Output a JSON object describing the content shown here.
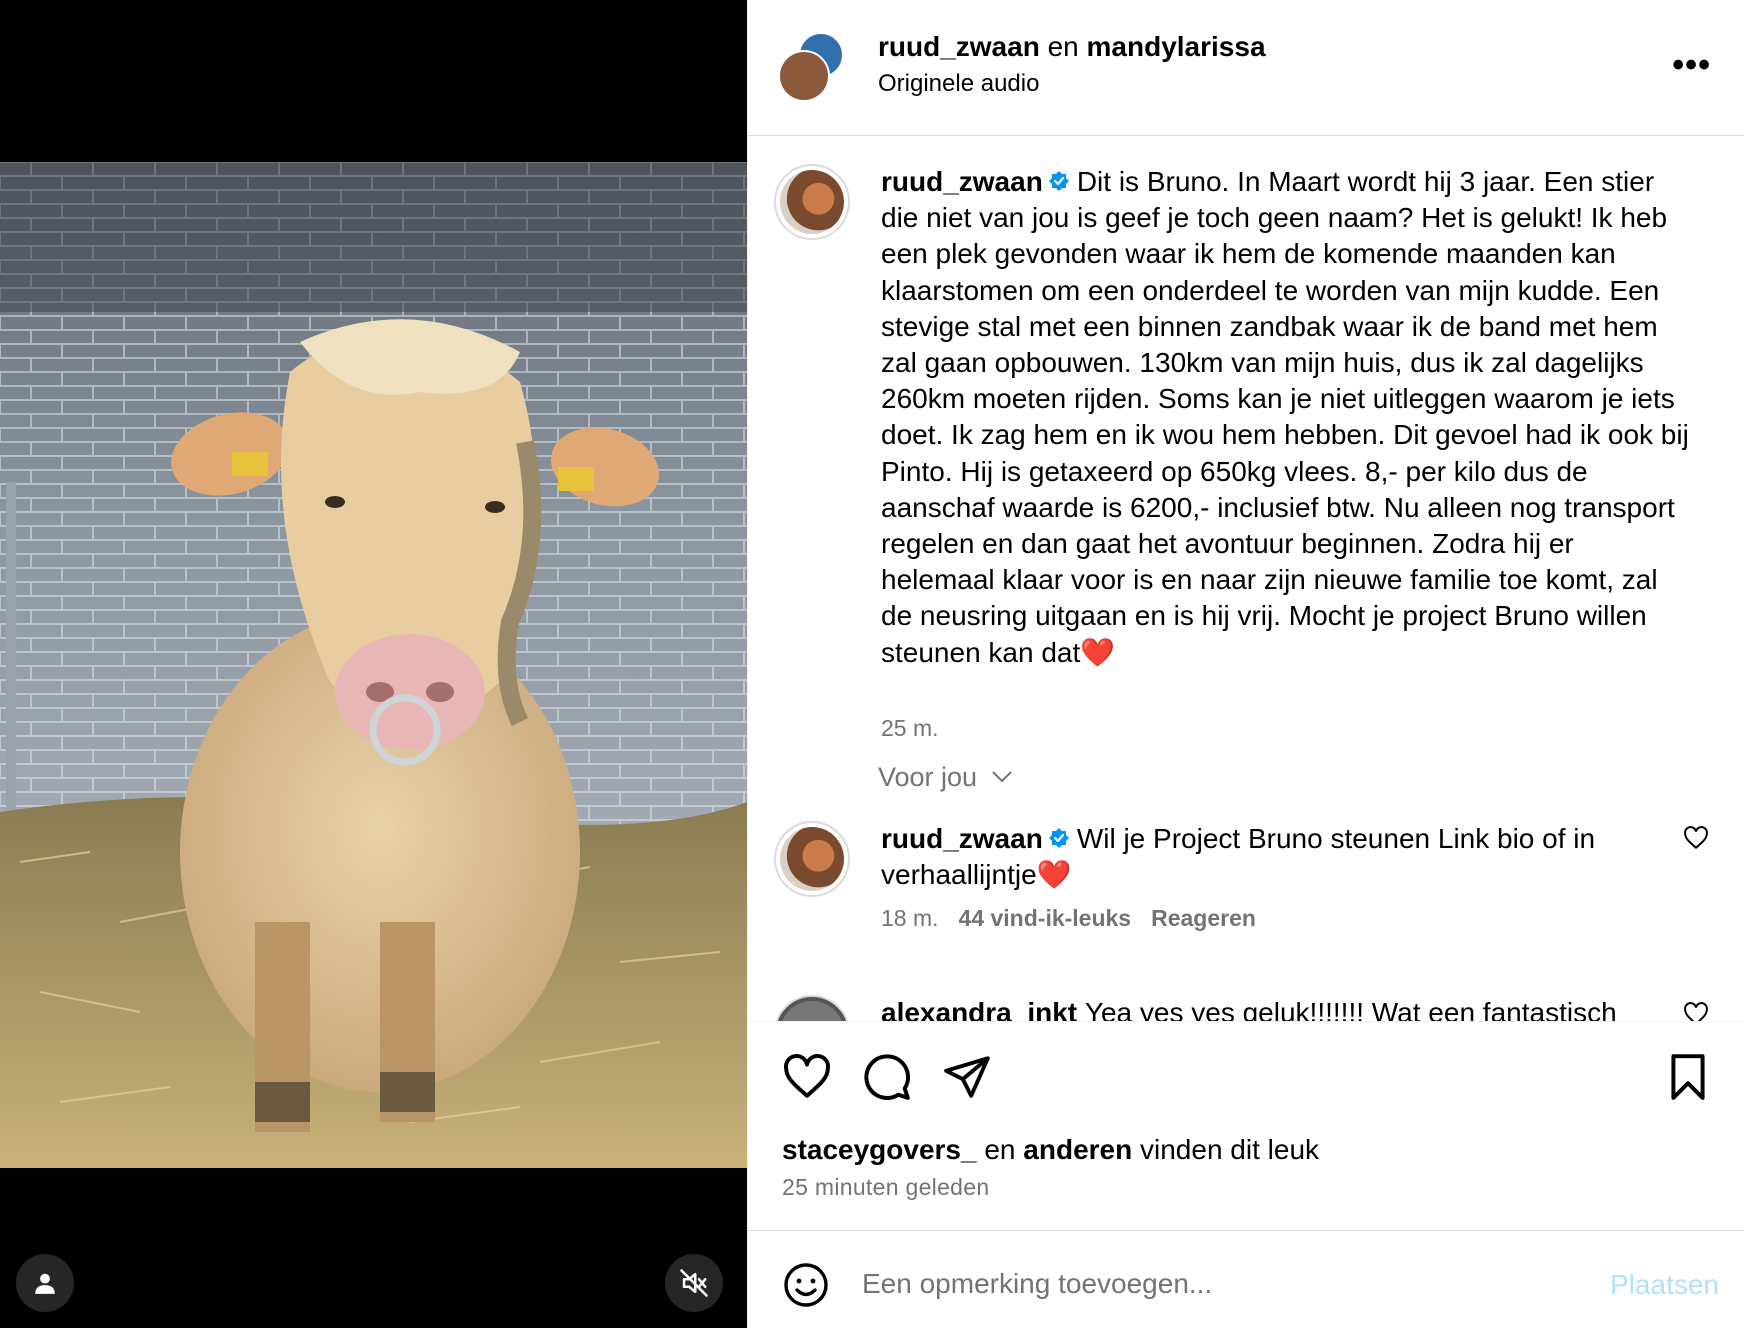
{
  "header": {
    "user1": "ruud_zwaan",
    "conj": "en",
    "user2": "mandylarissa",
    "audio": "Originele audio",
    "more_icon": "more-horizontal-icon"
  },
  "caption": {
    "username": "ruud_zwaan",
    "text": "Dit is Bruno. In Maart wordt hij 3 jaar. Een stier die niet van jou is geef je toch geen naam? Het is gelukt! Ik heb een plek gevonden waar ik hem de komende maanden kan klaarstomen om een onderdeel te worden van mijn kudde. Een stevige stal met een binnen zandbak waar ik de band met hem zal gaan opbouwen. 130km van mijn huis, dus ik zal dagelijks 260km moeten rijden. Soms kan je niet uitleggen waarom je iets doet. Ik zag hem en ik wou hem hebben. Dit gevoel had ik ook bij Pinto. Hij is getaxeerd op 650kg vlees. 8,- per kilo dus de aanschaf waarde is 6200,- inclusief btw. Nu alleen nog transport regelen en dan gaat het avontuur beginnen. Zodra hij er helemaal klaar voor is en naar zijn nieuwe familie toe komt, zal de neusring uitgaan en is hij vrij. Mocht je project Bruno willen steunen kan dat",
    "heart": "❤️",
    "time": "25 m."
  },
  "section_label": "Voor jou",
  "comments": [
    {
      "username": "ruud_zwaan",
      "text": "Wil je Project Bruno steunen Link bio of in verhaallijntje",
      "heart": "❤️",
      "time": "18 m.",
      "likes": "44 vind-ik-leuks",
      "reply": "Reageren"
    },
    {
      "username": "alexandra_inkt",
      "text": "Yea yes yes geluk!!!!!!! Wat een fantastisch"
    }
  ],
  "likes": {
    "user": "staceygovers_",
    "mid": "en",
    "others": "anderen",
    "tail": "vinden dit leuk"
  },
  "posted": "25 minuten geleden",
  "add_comment": {
    "placeholder": "Een opmerking toevoegen...",
    "post": "Plaatsen"
  },
  "colors": {
    "verified": "#0095f6",
    "muted": "#737373",
    "post_disabled": "#b2dffc"
  }
}
